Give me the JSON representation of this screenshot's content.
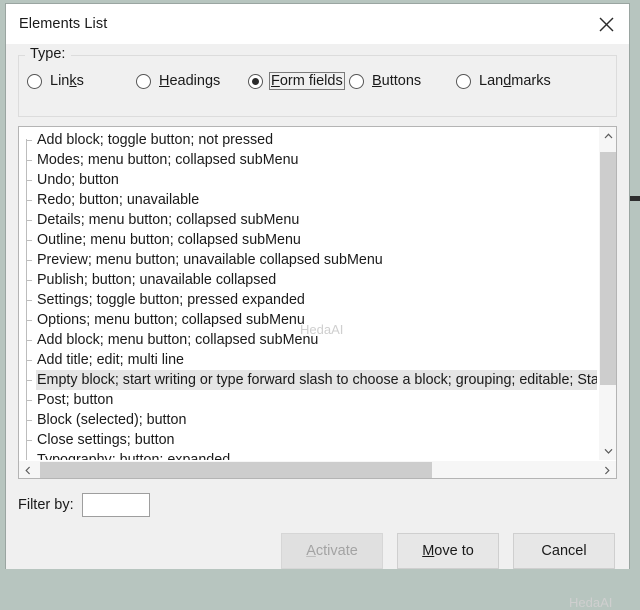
{
  "window": {
    "title": "Elements List",
    "close_icon": "close-icon"
  },
  "type_group": {
    "legend": "Type:",
    "options": [
      {
        "label": "Links",
        "mnemonic_index": 3,
        "checked": false
      },
      {
        "label": "Headings",
        "mnemonic_index": 0,
        "checked": false
      },
      {
        "label": "Form fields",
        "mnemonic_index": 0,
        "checked": true
      },
      {
        "label": "Buttons",
        "mnemonic_index": 0,
        "checked": false
      },
      {
        "label": "Landmarks",
        "mnemonic_index": 3,
        "checked": false
      }
    ]
  },
  "list": {
    "items": [
      {
        "text": "Add block; toggle button; not pressed",
        "selected": false
      },
      {
        "text": "Modes; menu button; collapsed subMenu",
        "selected": false
      },
      {
        "text": "Undo; button",
        "selected": false
      },
      {
        "text": "Redo; button; unavailable",
        "selected": false
      },
      {
        "text": "Details; menu button; collapsed subMenu",
        "selected": false
      },
      {
        "text": "Outline; menu button; collapsed subMenu",
        "selected": false
      },
      {
        "text": "Preview; menu button; unavailable collapsed subMenu",
        "selected": false
      },
      {
        "text": "Publish; button; unavailable collapsed",
        "selected": false
      },
      {
        "text": "Settings; toggle button; pressed expanded",
        "selected": false
      },
      {
        "text": "Options; menu button; collapsed subMenu",
        "selected": false
      },
      {
        "text": "Add block; menu button; collapsed subMenu",
        "selected": false
      },
      {
        "text": "Add title; edit; multi line",
        "selected": false
      },
      {
        "text": "Empty block; start writing or type forward slash to choose a block; grouping; editable; Sta",
        "selected": true
      },
      {
        "text": "Post; button",
        "selected": false
      },
      {
        "text": "Block (selected); button",
        "selected": false
      },
      {
        "text": "Close settings; button",
        "selected": false
      },
      {
        "text": "Typography; button; expanded",
        "selected": false
      }
    ],
    "vertical_scrollbar": {
      "up_arrow": "chevron-up-icon",
      "down_arrow": "chevron-down-icon"
    },
    "horizontal_scrollbar": {
      "left_arrow": "chevron-left-icon",
      "right_arrow": "chevron-right-icon"
    }
  },
  "filter": {
    "label": "Filter by:",
    "value": "",
    "placeholder": ""
  },
  "buttons": [
    {
      "label": "Activate",
      "mnemonic_index": 0,
      "disabled": true
    },
    {
      "label": "Move to",
      "mnemonic_index": 0,
      "disabled": false
    },
    {
      "label": "Cancel",
      "mnemonic_index": -1,
      "disabled": false
    }
  ],
  "watermarks": {
    "list_area": "HedaAI",
    "bottom_right": "HedaAI"
  },
  "colors": {
    "desktop_background": "#b7c5bf",
    "dialog_background": "#f0f0f0",
    "titlebar_background": "#ffffff",
    "list_background": "#ffffff",
    "selection_background": "#e5e5e5",
    "scrollbar_thumb": "#cdcdcd",
    "text": "#1a1a1a",
    "disabled_text": "#a3a3a3"
  }
}
